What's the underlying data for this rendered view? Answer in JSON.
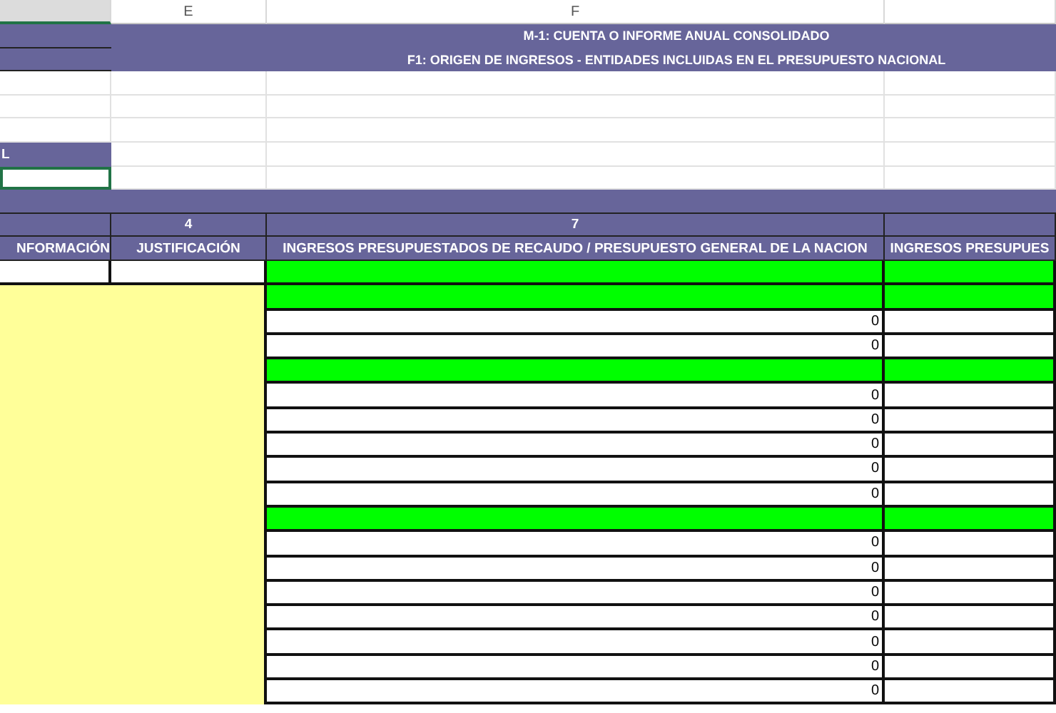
{
  "column_letters": [
    "E",
    "F"
  ],
  "title_lines": [
    "M-1: CUENTA O INFORME ANUAL CONSOLIDADO",
    "F1: ORIGEN DE INGRESOS - ENTIDADES INCLUIDAS EN EL PRESUPUESTO NACIONAL"
  ],
  "side_label": "L",
  "column_numbers": [
    "4",
    "7"
  ],
  "column_titles": [
    "NFORMACIÓN",
    "JUSTIFICACIÓN",
    "INGRESOS PRESUPUESTADOS DE RECAUDO / PRESUPUESTO GENERAL DE LA NACION",
    "INGRESOS PRESUPUES"
  ],
  "rows": [
    {
      "kind": "group"
    },
    {
      "kind": "group"
    },
    {
      "kind": "value",
      "value": "0"
    },
    {
      "kind": "value",
      "value": "0"
    },
    {
      "kind": "group"
    },
    {
      "kind": "value",
      "value": "0"
    },
    {
      "kind": "value",
      "value": "0"
    },
    {
      "kind": "value",
      "value": "0"
    },
    {
      "kind": "value",
      "value": "0"
    },
    {
      "kind": "value",
      "value": "0"
    },
    {
      "kind": "group"
    },
    {
      "kind": "value",
      "value": "0"
    },
    {
      "kind": "value",
      "value": "0"
    },
    {
      "kind": "value",
      "value": "0"
    },
    {
      "kind": "value",
      "value": "0"
    },
    {
      "kind": "value",
      "value": "0"
    },
    {
      "kind": "value",
      "value": "0"
    },
    {
      "kind": "value",
      "value": "0"
    }
  ]
}
